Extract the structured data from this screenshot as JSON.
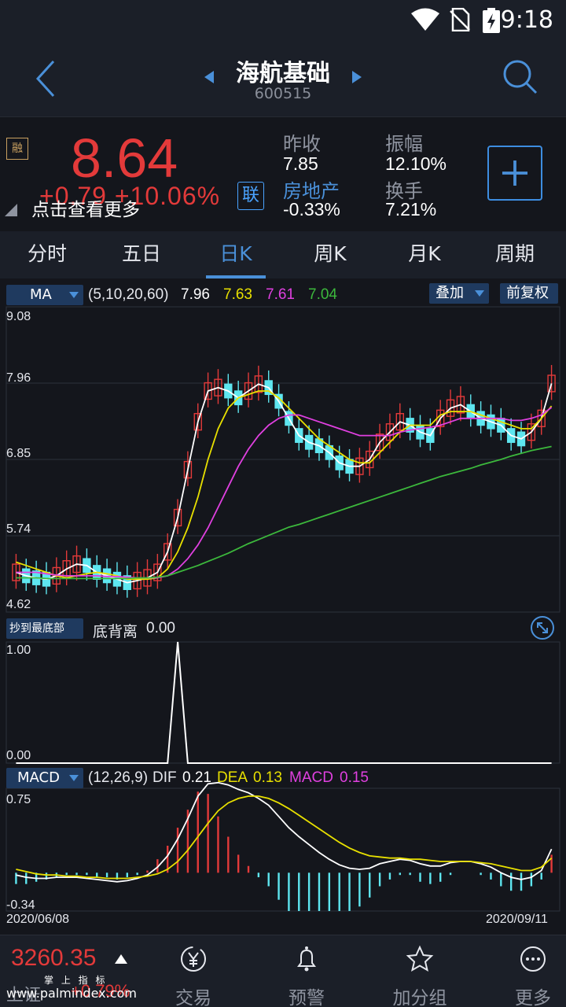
{
  "status_bar": {
    "time": "9:18"
  },
  "header": {
    "stock_name": "海航基础",
    "stock_code": "600515"
  },
  "quote": {
    "rong_badge": "融",
    "price": "8.64",
    "change": "+0.79  +10.06%",
    "tap_hint": "点击查看更多",
    "lian_label": "联",
    "prev_close_label": "昨收",
    "prev_close": "7.85",
    "sector": "房地产",
    "sector_change": "-0.33%",
    "amplitude_label": "振幅",
    "amplitude": "12.10%",
    "turnover_label": "换手",
    "turnover": "7.21%"
  },
  "tabs": [
    "分时",
    "五日",
    "日K",
    "周K",
    "月K",
    "周期"
  ],
  "active_tab": "日K",
  "ma_panel": {
    "indicator": "MA",
    "params": "(5,10,20,60)",
    "ma5": "7.96",
    "ma10": "7.63",
    "ma20": "7.61",
    "ma60": "7.04",
    "overlay_label": "叠加",
    "adjust_label": "前复权",
    "y_ticks": [
      "9.08",
      "7.96",
      "6.85",
      "5.74",
      "4.62"
    ]
  },
  "bottom_panel": {
    "indicator": "抄到最底部",
    "name": "底背离",
    "value": "0.00",
    "y_ticks": [
      "1.00",
      "0.00"
    ]
  },
  "macd_panel": {
    "indicator": "MACD",
    "params": "(12,26,9)",
    "dif_label": "DIF",
    "dif": "0.21",
    "dea_label": "DEA",
    "dea": "0.13",
    "macd_label": "MACD",
    "macd": "0.15",
    "y_ticks": [
      "0.75",
      "-0.34"
    ],
    "start_date": "2020/06/08",
    "end_date": "2020/09/11"
  },
  "colors": {
    "up": "#e33a3a",
    "down": "#5ee6f0",
    "ma5": "#ffffff",
    "ma10": "#e8e000",
    "ma20": "#e040e0",
    "ma60": "#3cb83c",
    "accent": "#4a90d9"
  },
  "bottom_nav": {
    "index_value": "3260.35",
    "index_name": "上证",
    "index_pct": "+0.79%",
    "watermark_top": "掌 上 指 标",
    "watermark_url": "www.palmindex.com",
    "items": [
      "交易",
      "预警",
      "加分组",
      "更多"
    ]
  },
  "chart_data": [
    {
      "type": "line",
      "title": "",
      "description": "Daily K-line with moving averages MA5/MA10/MA20/MA60",
      "ylim": [
        4.62,
        9.08
      ],
      "x_start": "2020/06/08",
      "x_end": "2020/09/11",
      "series": [
        {
          "name": "MA5",
          "values": [
            5.2,
            5.15,
            5.12,
            5.1,
            5.15,
            5.25,
            5.32,
            5.3,
            5.2,
            5.15,
            5.1,
            5.05,
            5.08,
            5.12,
            5.2,
            5.5,
            6.0,
            6.7,
            7.4,
            7.85,
            7.9,
            7.85,
            7.75,
            7.85,
            7.95,
            7.9,
            7.7,
            7.45,
            7.2,
            7.1,
            7.05,
            6.95,
            6.8,
            6.75,
            6.75,
            6.85,
            7.1,
            7.25,
            7.4,
            7.35,
            7.25,
            7.2,
            7.45,
            7.6,
            7.65,
            7.55,
            7.45,
            7.4,
            7.35,
            7.2,
            7.15,
            7.25,
            7.45,
            7.96
          ]
        },
        {
          "name": "MA10",
          "values": [
            5.35,
            5.3,
            5.25,
            5.2,
            5.15,
            5.12,
            5.15,
            5.18,
            5.2,
            5.18,
            5.15,
            5.1,
            5.1,
            5.1,
            5.12,
            5.25,
            5.5,
            5.85,
            6.3,
            6.85,
            7.3,
            7.6,
            7.75,
            7.8,
            7.85,
            7.85,
            7.75,
            7.6,
            7.45,
            7.3,
            7.15,
            7.05,
            6.95,
            6.85,
            6.8,
            6.8,
            6.95,
            7.1,
            7.25,
            7.35,
            7.35,
            7.35,
            7.5,
            7.55,
            7.55,
            7.55,
            7.5,
            7.45,
            7.4,
            7.35,
            7.3,
            7.3,
            7.45,
            7.63
          ]
        },
        {
          "name": "MA20",
          "values": [
            5.2,
            5.2,
            5.2,
            5.18,
            5.16,
            5.15,
            5.15,
            5.15,
            5.15,
            5.14,
            5.14,
            5.13,
            5.12,
            5.12,
            5.12,
            5.15,
            5.25,
            5.4,
            5.6,
            5.85,
            6.15,
            6.45,
            6.75,
            7.0,
            7.2,
            7.35,
            7.45,
            7.5,
            7.5,
            7.45,
            7.4,
            7.35,
            7.3,
            7.25,
            7.2,
            7.2,
            7.2,
            7.2,
            7.25,
            7.28,
            7.3,
            7.32,
            7.35,
            7.4,
            7.45,
            7.45,
            7.45,
            7.45,
            7.45,
            7.42,
            7.42,
            7.45,
            7.5,
            7.61
          ]
        },
        {
          "name": "MA60",
          "values": [
            5.12,
            5.12,
            5.12,
            5.11,
            5.11,
            5.11,
            5.11,
            5.11,
            5.11,
            5.11,
            5.11,
            5.11,
            5.12,
            5.12,
            5.13,
            5.15,
            5.2,
            5.25,
            5.3,
            5.36,
            5.42,
            5.48,
            5.55,
            5.62,
            5.68,
            5.74,
            5.8,
            5.86,
            5.9,
            5.95,
            6.0,
            6.05,
            6.1,
            6.15,
            6.2,
            6.25,
            6.3,
            6.35,
            6.4,
            6.45,
            6.5,
            6.55,
            6.6,
            6.64,
            6.68,
            6.72,
            6.77,
            6.81,
            6.85,
            6.9,
            6.94,
            6.98,
            7.01,
            7.04
          ]
        }
      ]
    },
    {
      "type": "line",
      "title": "",
      "description": "底背离 indicator",
      "ylim": [
        0,
        1
      ],
      "series": [
        {
          "name": "底背离",
          "values": [
            0,
            0,
            0,
            0,
            0,
            0,
            0,
            0,
            0,
            0,
            0,
            0,
            0,
            0,
            0,
            0,
            1,
            0,
            0,
            0,
            0,
            0,
            0,
            0,
            0,
            0,
            0,
            0,
            0,
            0,
            0,
            0,
            0,
            0,
            0,
            0,
            0,
            0,
            0,
            0,
            0,
            0,
            0,
            0,
            0,
            0,
            0,
            0,
            0,
            0,
            0,
            0,
            0,
            0
          ]
        }
      ]
    },
    {
      "type": "line",
      "title": "",
      "description": "MACD (12,26,9)",
      "ylim": [
        -0.34,
        0.75
      ],
      "series": [
        {
          "name": "DIF",
          "values": [
            -0.02,
            -0.04,
            -0.05,
            -0.05,
            -0.04,
            -0.04,
            -0.04,
            -0.05,
            -0.06,
            -0.07,
            -0.08,
            -0.07,
            -0.05,
            -0.02,
            0.05,
            0.15,
            0.3,
            0.48,
            0.68,
            0.79,
            0.8,
            0.78,
            0.74,
            0.71,
            0.66,
            0.6,
            0.5,
            0.4,
            0.32,
            0.25,
            0.18,
            0.12,
            0.07,
            0.04,
            0.03,
            0.04,
            0.08,
            0.1,
            0.12,
            0.11,
            0.08,
            0.06,
            0.06,
            0.09,
            0.1,
            0.1,
            0.08,
            0.05,
            0.0,
            -0.04,
            -0.06,
            -0.04,
            0.02,
            0.21
          ]
        },
        {
          "name": "DEA",
          "values": [
            0.03,
            0.01,
            -0.01,
            -0.02,
            -0.02,
            -0.03,
            -0.03,
            -0.04,
            -0.04,
            -0.05,
            -0.05,
            -0.05,
            -0.04,
            -0.03,
            -0.01,
            0.03,
            0.1,
            0.2,
            0.32,
            0.44,
            0.55,
            0.62,
            0.66,
            0.68,
            0.68,
            0.66,
            0.62,
            0.57,
            0.51,
            0.45,
            0.39,
            0.33,
            0.27,
            0.22,
            0.18,
            0.15,
            0.14,
            0.13,
            0.13,
            0.12,
            0.12,
            0.11,
            0.1,
            0.1,
            0.1,
            0.1,
            0.09,
            0.08,
            0.06,
            0.04,
            0.02,
            0.02,
            0.05,
            0.13
          ]
        }
      ]
    }
  ]
}
